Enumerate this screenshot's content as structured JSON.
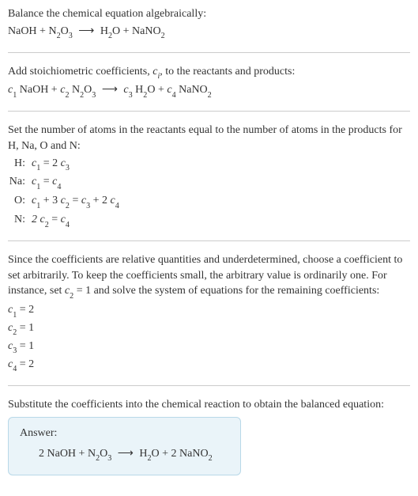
{
  "intro": {
    "line1": "Balance the chemical equation algebraically:",
    "eq_left1": "NaOH + N",
    "eq_left2": "O",
    "eq_right1": "H",
    "eq_right2": "O + NaNO"
  },
  "step2": {
    "line1_a": "Add stoichiometric coefficients, ",
    "line1_b": ", to the reactants and products:",
    "ci": "c",
    "ci_sub": "i",
    "c1": "c",
    "c1s": "1",
    "c2": "c",
    "c2s": "2",
    "c3": "c",
    "c3s": "3",
    "c4": "c",
    "c4s": "4",
    "sp1": " NaOH + ",
    "sp2": " N",
    "sp3": "O",
    "sp4": "H",
    "sp5": "O + ",
    "sp6": " NaNO"
  },
  "step3": {
    "intro": "Set the number of atoms in the reactants equal to the number of atoms in the products for H, Na, O and N:",
    "rows": [
      {
        "label": "H:",
        "lhs_a": "c",
        "lhs_as": "1",
        "mid": " = 2",
        "rhs_a": "c",
        "rhs_as": "3",
        "tail": ""
      },
      {
        "label": "Na:",
        "lhs_a": "c",
        "lhs_as": "1",
        "mid": " = ",
        "rhs_a": "c",
        "rhs_as": "4",
        "tail": ""
      },
      {
        "label": "O:",
        "lhs_a": "c",
        "lhs_as": "1",
        "mid": " + 3",
        "rhs_a": "c",
        "rhs_as": "2",
        "tail_a": " = ",
        "t1": "c",
        "t1s": "3",
        "tail_b": " + 2",
        "t2": "c",
        "t2s": "4"
      },
      {
        "label": "N:",
        "lhs_a": "2 c",
        "lhs_as": "2",
        "mid": " = ",
        "rhs_a": "c",
        "rhs_as": "4",
        "tail": ""
      }
    ]
  },
  "step4": {
    "para_a": "Since the coefficients are relative quantities and underdetermined, choose a coefficient to set arbitrarily. To keep the coefficients small, the arbitrary value is ordinarily one. For instance, set ",
    "para_b": " = 1 and solve the system of equations for the remaining coefficients:",
    "c2": "c",
    "c2s": "2",
    "lines": [
      {
        "v": "c",
        "s": "1",
        "eq": " = 2"
      },
      {
        "v": "c",
        "s": "2",
        "eq": " = 1"
      },
      {
        "v": "c",
        "s": "3",
        "eq": " = 1"
      },
      {
        "v": "c",
        "s": "4",
        "eq": " = 2"
      }
    ]
  },
  "step5": {
    "para": "Substitute the coefficients into the chemical reaction to obtain the balanced equation:"
  },
  "answer": {
    "label": "Answer:",
    "eq_a": "2 NaOH + N",
    "eq_b": "O",
    "eq_c": "H",
    "eq_d": "O + 2 NaNO"
  },
  "subs": {
    "two": "2",
    "three": "3"
  },
  "arrow": "⟶",
  "chart_data": {
    "type": "table",
    "title": "Balanced chemical equation coefficients",
    "reactants": [
      {
        "species": "NaOH",
        "coefficient": 2
      },
      {
        "species": "N2O3",
        "coefficient": 1
      }
    ],
    "products": [
      {
        "species": "H2O",
        "coefficient": 1
      },
      {
        "species": "NaNO2",
        "coefficient": 2
      }
    ],
    "atom_balance": [
      {
        "element": "H",
        "equation": "c1 = 2 c3"
      },
      {
        "element": "Na",
        "equation": "c1 = c4"
      },
      {
        "element": "O",
        "equation": "c1 + 3 c2 = c3 + 2 c4"
      },
      {
        "element": "N",
        "equation": "2 c2 = c4"
      }
    ],
    "solution": {
      "c1": 2,
      "c2": 1,
      "c3": 1,
      "c4": 2
    }
  }
}
